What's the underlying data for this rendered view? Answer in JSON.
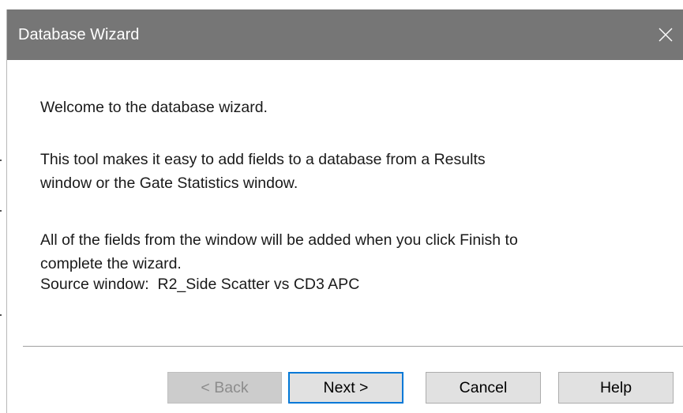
{
  "dialog": {
    "title": "Database Wizard",
    "close_icon": "close-icon"
  },
  "content": {
    "welcome": "Welcome to the database wizard.",
    "description_line1": "This tool makes it easy to add fields to a database from a Results",
    "description_line2": "window or the Gate Statistics window.",
    "finish_line1": "All of the fields from the window will be added when you click Finish to",
    "finish_line2": "complete the wizard.",
    "source_label": "Source window:",
    "source_value": "R2_Side Scatter vs CD3 APC"
  },
  "buttons": {
    "back": "< Back",
    "next": "Next >",
    "cancel": "Cancel",
    "help": "Help"
  },
  "colors": {
    "titlebar": "#767676",
    "default_button_border": "#0078d7",
    "button_face": "#e1e1e1"
  }
}
